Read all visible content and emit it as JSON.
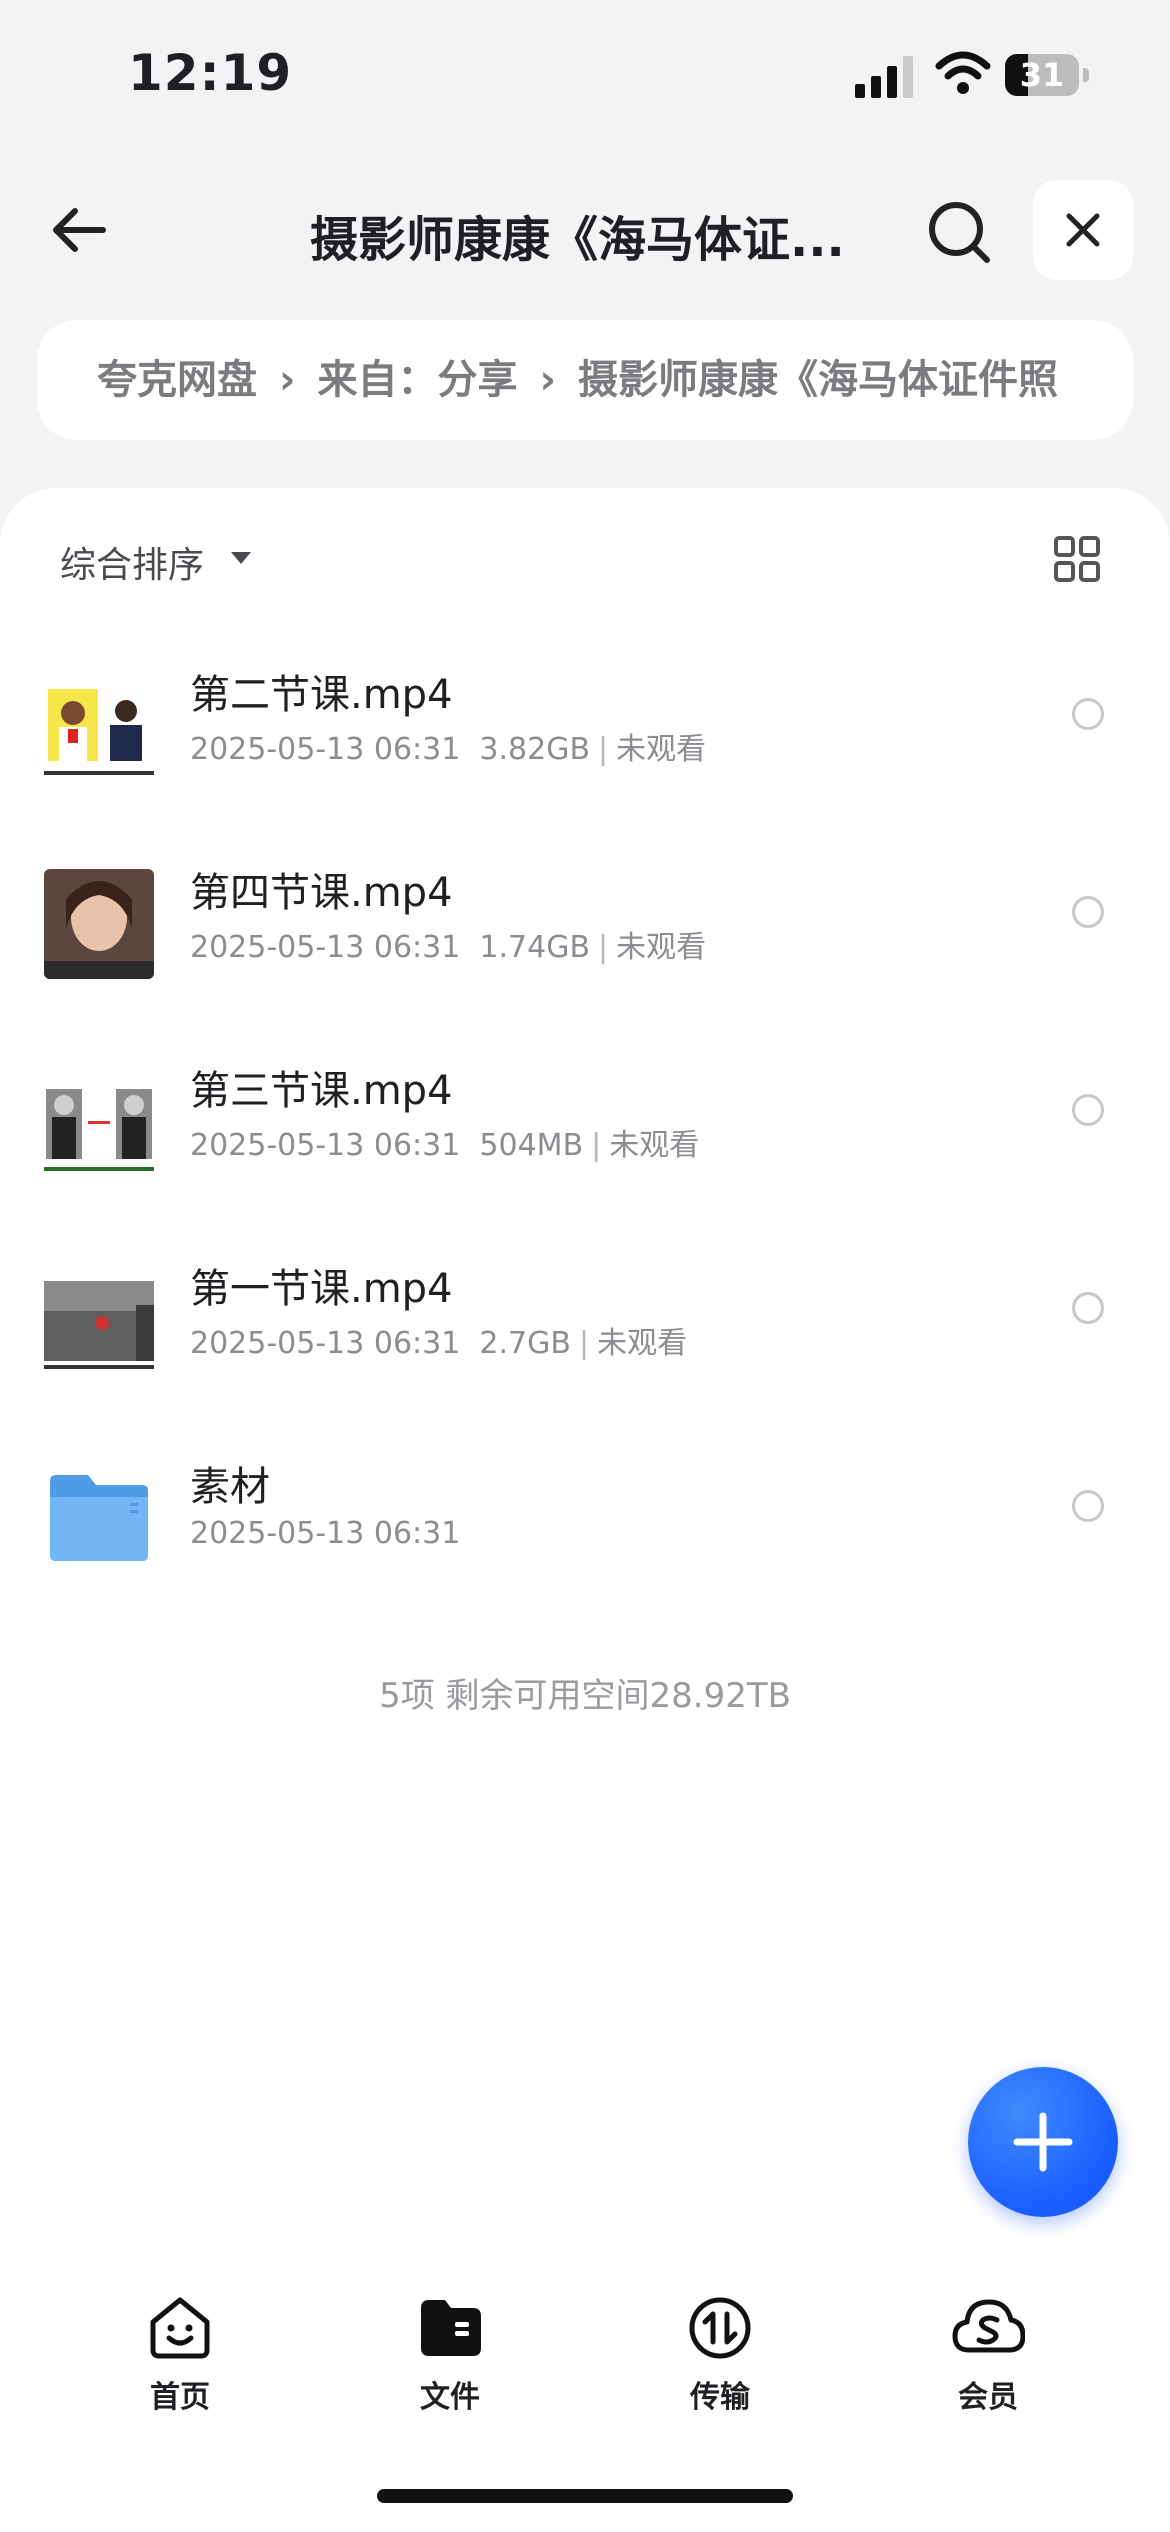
{
  "status_bar": {
    "time": "12:19",
    "battery": "31",
    "battery_level": 0.31
  },
  "header": {
    "title": "摄影师康康《海马体证...",
    "back_icon": "arrow-left-icon",
    "search_icon": "search-icon",
    "close_icon": "close-icon"
  },
  "breadcrumb": {
    "items": [
      "夸克网盘",
      "来自：分享",
      "摄影师康康《海马体证件照"
    ]
  },
  "toolbar": {
    "sort_label": "综合排序"
  },
  "files": [
    {
      "name": "第二节课.mp4",
      "date": "2025-05-13 06:31",
      "size": "3.82GB",
      "status": "未观看"
    },
    {
      "name": "第四节课.mp4",
      "date": "2025-05-13 06:31",
      "size": "1.74GB",
      "status": "未观看"
    },
    {
      "name": "第三节课.mp4",
      "date": "2025-05-13 06:31",
      "size": "504MB",
      "status": "未观看"
    },
    {
      "name": "第一节课.mp4",
      "date": "2025-05-13 06:31",
      "size": "2.7GB",
      "status": "未观看"
    },
    {
      "name": "素材",
      "date": "2025-05-13 06:31"
    }
  ],
  "summary": "5项 剩余可用空间28.92TB",
  "tabbar": {
    "items": [
      {
        "label": "首页"
      },
      {
        "label": "文件"
      },
      {
        "label": "传输"
      },
      {
        "label": "会员"
      }
    ]
  },
  "colors": {
    "accent": "#1a5cff",
    "folder": "#6aaef0"
  }
}
